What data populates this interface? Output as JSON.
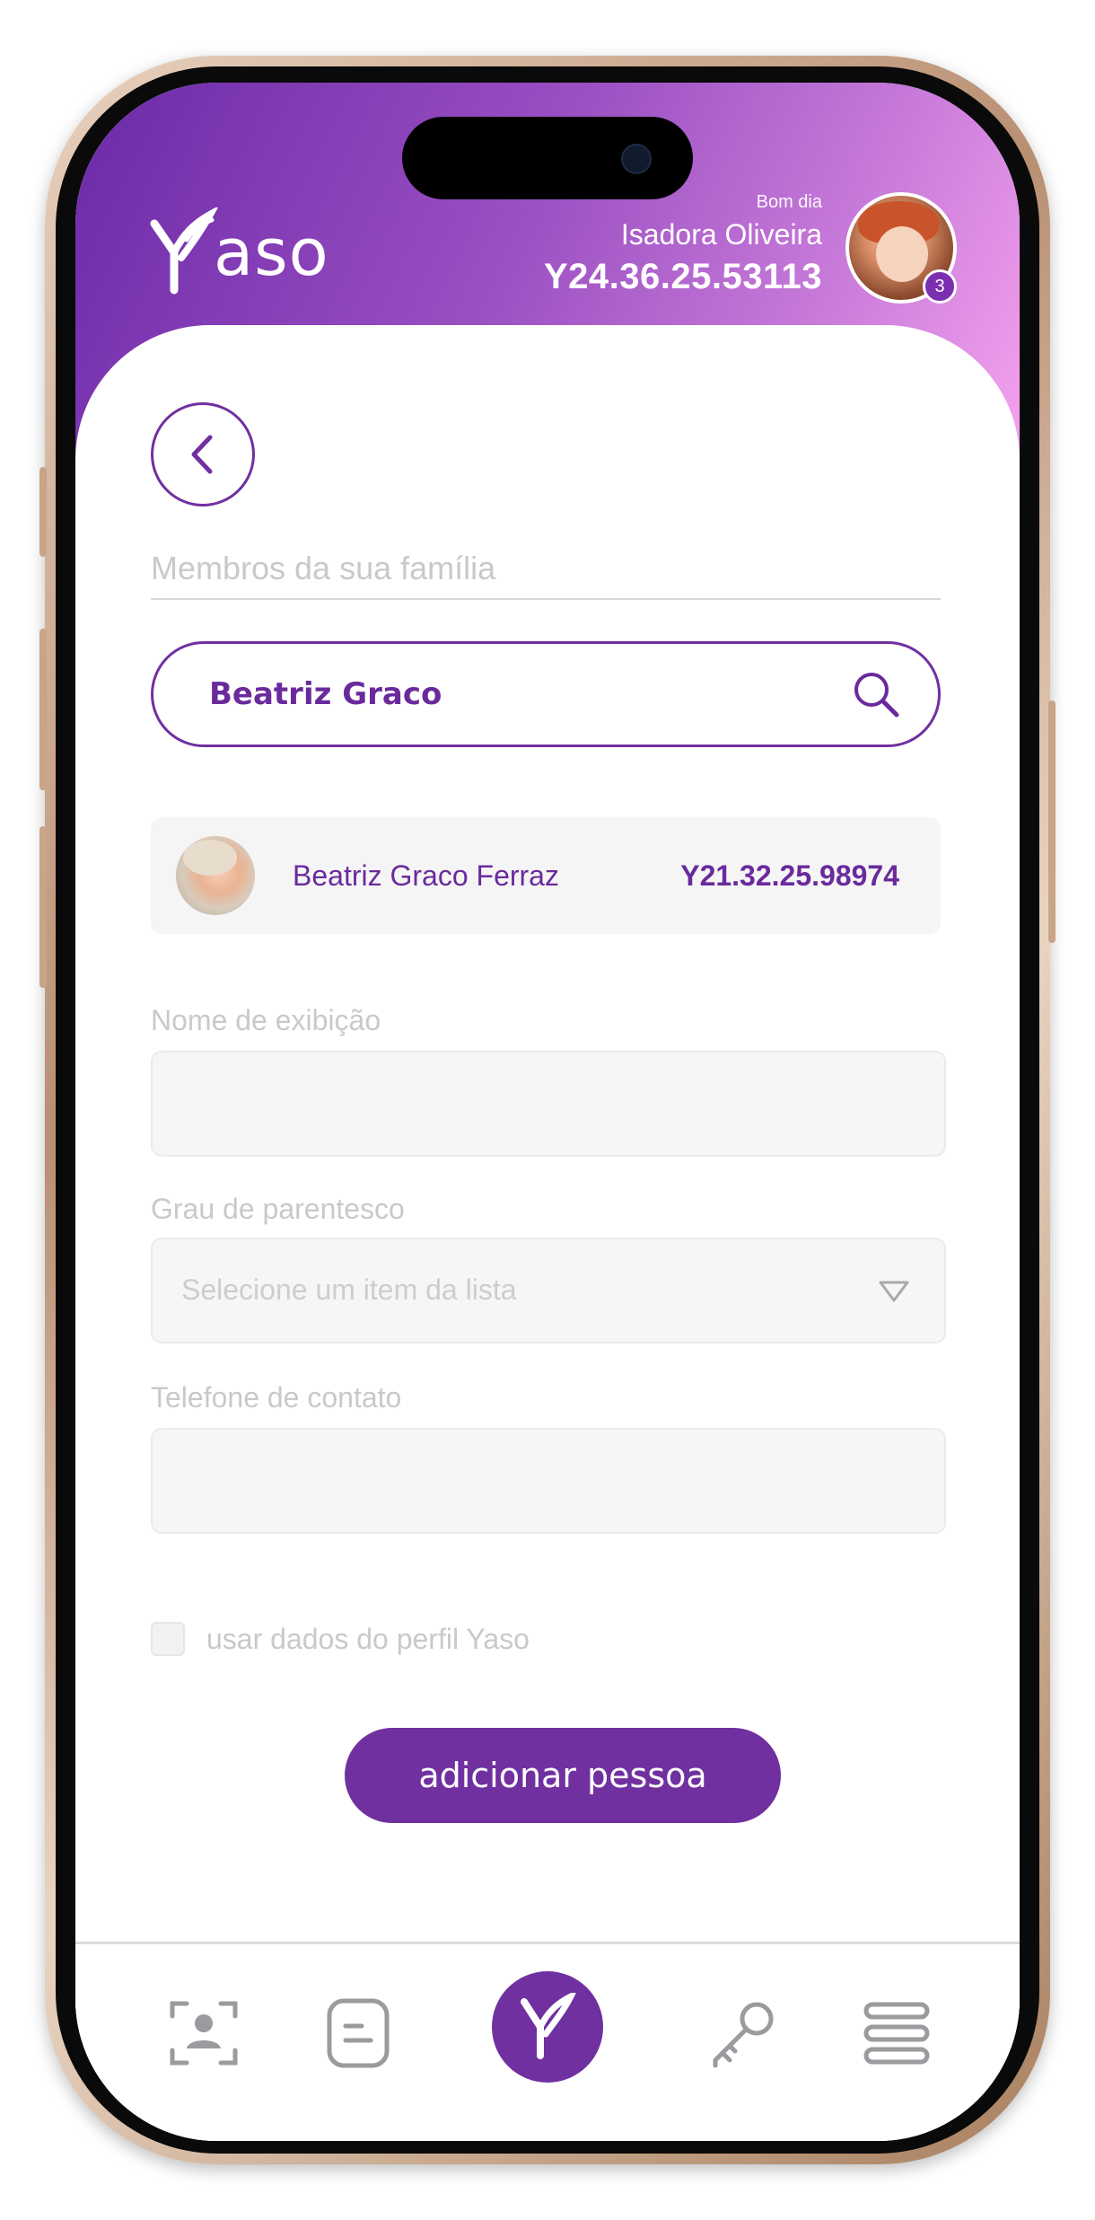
{
  "header": {
    "logo_text": "aso",
    "greeting": "Bom dia",
    "user_name": "Isadora Oliveira",
    "user_code": "Y24.36.25.53113",
    "notification_count": "3"
  },
  "section_title": "Membros da sua família",
  "search": {
    "value": "Beatriz Graco"
  },
  "result": {
    "name": "Beatriz Graco Ferraz",
    "code": "Y21.32.25.98974"
  },
  "form": {
    "display_name_label": "Nome de exibição",
    "relation_label": "Grau de parentesco",
    "relation_placeholder": "Selecione um item da lista",
    "phone_label": "Telefone de contato",
    "use_profile_label": "usar dados do perfil Yaso",
    "submit_label": "adicionar pessoa"
  },
  "nav": {
    "items": [
      "face-scan-icon",
      "document-icon",
      "yaso-home-icon",
      "key-icon",
      "menu-icon"
    ]
  },
  "colors": {
    "brand_purple": "#7030a0",
    "gradient_pink": "#f6a3ee"
  }
}
